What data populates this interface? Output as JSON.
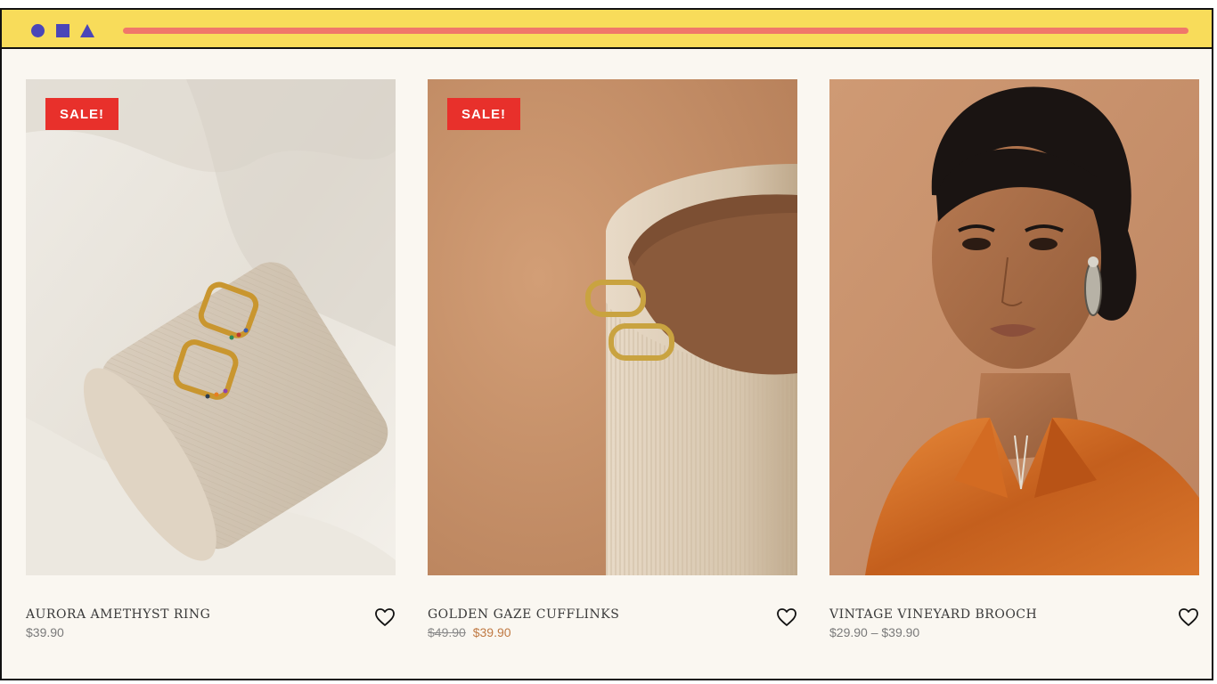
{
  "browser": {
    "colors": {
      "bar": "#f8dc5a",
      "shapes": "#4a46b8",
      "address": "#f0776a"
    }
  },
  "products": [
    {
      "title": "AURORA AMETHYST RING",
      "price": "$39.90",
      "badge": "SALE!",
      "image": "gold-rainbow-hoop-earrings-on-stone"
    },
    {
      "title": "GOLDEN GAZE CUFFLINKS",
      "old_price": "$49.90",
      "sale_price": "$39.90",
      "badge": "SALE!",
      "image": "gold-hoops-on-ceramic-vase"
    },
    {
      "title": "VINTAGE VINEYARD BROOCH",
      "price": "$29.90 – $39.90",
      "image": "model-in-orange-satin-shirt"
    }
  ],
  "icons": {
    "wishlist": "heart-icon"
  },
  "accent_colors": {
    "sale_badge": "#e8302b",
    "sale_price": "#c07a44"
  }
}
